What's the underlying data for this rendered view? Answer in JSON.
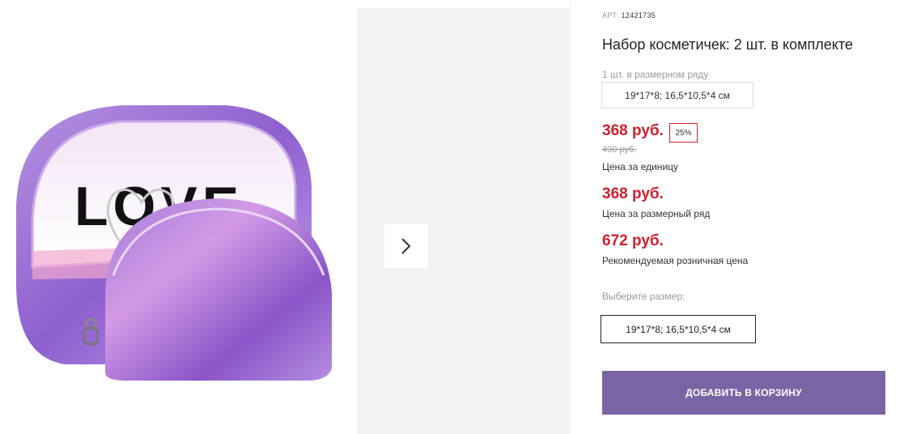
{
  "product": {
    "art_label": "АРТ:",
    "art_number": "12421735",
    "title": "Набор косметичек: 2 шт. в комплекте",
    "row_note": "1 шт. в размерном ряду",
    "size_chip": "19*17*8; 16,5*10,5*4 см",
    "price_unit": "368 руб.",
    "discount": "25%",
    "old_price": "490 руб.",
    "price_unit_caption": "Цена за единицу",
    "price_row": "368 руб.",
    "price_row_caption": "Цена за размерный ряд",
    "price_retail": "672 руб.",
    "price_retail_caption": "Рекомендуемая розничная цена",
    "select_label": "Выберите размер:",
    "selected_size": "19*17*8; 16,5*10,5*4 см",
    "add_button": "ДОБАВИТЬ В КОРЗИНУ"
  },
  "image": {
    "print_text": "LOVE"
  },
  "colors": {
    "accent": "#7a64a4",
    "price": "#d0202e"
  },
  "icons": {
    "next": "chevron-right-icon"
  }
}
